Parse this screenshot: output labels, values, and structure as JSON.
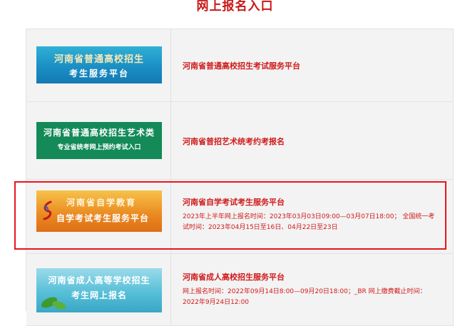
{
  "page": {
    "title": "网上报名入口"
  },
  "entries": [
    {
      "logo": {
        "line1": "河南省普通高校招生",
        "line2": "考生服务平台"
      },
      "link": "河南省普通高校招生考试服务平台"
    },
    {
      "logo": {
        "line1": "河南省普通高校招生艺术类",
        "line2": "专业省统考网上预约考试入口"
      },
      "link": "河南省普招艺术统考约考报名"
    },
    {
      "logo": {
        "line1": "河南省自学教育",
        "line2": "自学考试考生服务平台"
      },
      "link": "河南省自学考试考生服务平台",
      "detail": "2023年上半年网上报名时间：2023年03月03日09:00—03月07日18:00； 全国统一考试时间：2023年04月15日至16日、04月22日至23日"
    },
    {
      "logo": {
        "line1": "河南省成人高等学校招生",
        "line2": "考生网上报名"
      },
      "link": "河南省成人高校招生服务平台",
      "detail": "网上报名时间：2022年09月14日8:00—09月20日18:00；_BR 网上缴费截止时间：2022年9月24日12:00"
    }
  ],
  "colors": {
    "accent_red": "#d01a1a",
    "highlight_border": "#e8151b",
    "cell_bg": "#f3f3f3"
  },
  "icons": {
    "zikao_logo_mark": "red-swoosh-icon",
    "chengren_logo_mark": "green-leaf-icon"
  }
}
